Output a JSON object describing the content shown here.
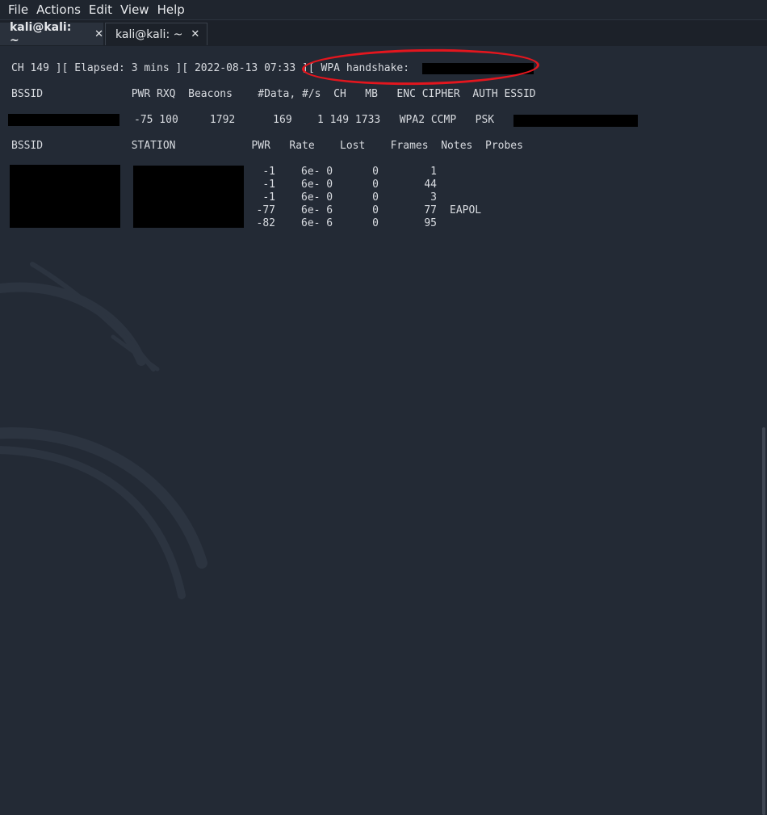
{
  "menubar": {
    "items": [
      "File",
      "Actions",
      "Edit",
      "View",
      "Help"
    ]
  },
  "tabs": [
    {
      "label": "kali@kali: ~",
      "active": true
    },
    {
      "label": "kali@kali: ~",
      "active": false
    }
  ],
  "close_glyph": "✕",
  "terminal": {
    "status_line": "CH 149 ][ Elapsed: 3 mins ][ 2022-08-13 07:33 ][ WPA handshake:",
    "ap_header": "BSSID              PWR RXQ  Beacons    #Data, #/s  CH   MB   ENC CIPHER  AUTH ESSID",
    "ap_row": "-75 100     1792      169    1 149 1733   WPA2 CCMP   PSK",
    "station_header": "BSSID              STATION            PWR   Rate    Lost    Frames  Notes  Probes",
    "stations": [
      {
        "pwr": "-1",
        "rate": "6e- 0",
        "lost": "0",
        "frames": "1",
        "notes": ""
      },
      {
        "pwr": "-1",
        "rate": "6e- 0",
        "lost": "0",
        "frames": "44",
        "notes": ""
      },
      {
        "pwr": "-1",
        "rate": "6e- 0",
        "lost": "0",
        "frames": "3",
        "notes": ""
      },
      {
        "pwr": "-77",
        "rate": "6e- 6",
        "lost": "0",
        "frames": "77",
        "notes": "EAPOL"
      },
      {
        "pwr": "-82",
        "rate": "6e- 6",
        "lost": "0",
        "frames": "95",
        "notes": ""
      }
    ]
  },
  "colors": {
    "background": "#232a35",
    "text": "#d8dbe0",
    "highlight_ring": "#e3161e",
    "redaction": "#000000"
  }
}
